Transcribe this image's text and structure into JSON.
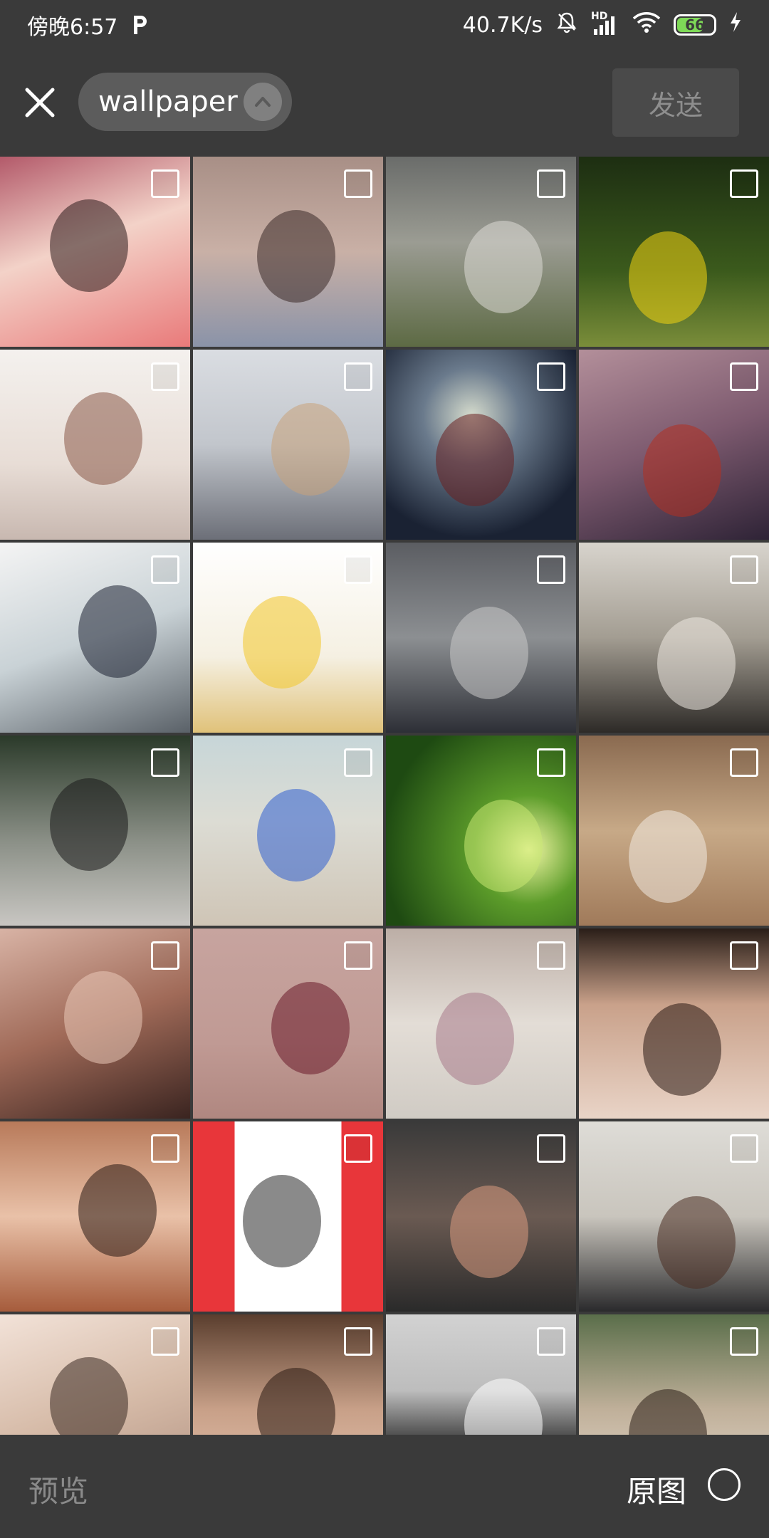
{
  "status_bar": {
    "time": "傍晚6:57",
    "app_icon": "p-icon",
    "network_speed": "40.7K/s",
    "hd_label": "HD",
    "battery_level": "66",
    "icons": [
      "mute-icon",
      "signal-icon",
      "wifi-icon",
      "battery-icon",
      "charging-icon"
    ]
  },
  "header": {
    "close_icon": "close-icon",
    "album_name": "wallpaper",
    "album_toggle_icon": "chevron-up-icon",
    "send_label": "发送"
  },
  "grid": {
    "columns": 4,
    "tiles": [
      {
        "name": "girl-kimono-photo",
        "bg": "linear-gradient(160deg,#b35a6a 0%,#f3d2c8 45%,#e97a7a 100%)",
        "accent": "#2b1b1b"
      },
      {
        "name": "girl-sitting-photo",
        "bg": "linear-gradient(180deg,#a88f86 0%,#c9b0a6 50%,#8a93a8 100%)",
        "accent": "#3a2a28"
      },
      {
        "name": "man-field-photo",
        "bg": "linear-gradient(180deg,#6a6c6a 0%,#9b9c93 45%,#5d6a44 100%)",
        "accent": "#dcdad5"
      },
      {
        "name": "yellow-flowers-photo",
        "bg": "linear-gradient(180deg,#1d2e12 0%,#3b5a1c 60%,#7a8d3a 100%)",
        "accent": "#f2d413"
      },
      {
        "name": "anime-couple-illustration",
        "bg": "linear-gradient(180deg,#f4f1ee 0%,#e8ddd6 60%,#c8b8b0 100%)",
        "accent": "#8a5a48"
      },
      {
        "name": "sleeping-dog-photo",
        "bg": "linear-gradient(180deg,#dadde2 0%,#c2c6cc 50%,#6c6f78 100%)",
        "accent": "#c9a27a"
      },
      {
        "name": "moon-window-illustration",
        "bg": "radial-gradient(circle at 45% 35%,#d6dccd 0%,#6a7a8c 30%,#1a2233 75%)",
        "accent": "#6a2020"
      },
      {
        "name": "figure-on-sofa-illustration",
        "bg": "linear-gradient(160deg,#b38f9a 0%,#7d5a6f 50%,#2e2336 100%)",
        "accent": "#b23020"
      },
      {
        "name": "figure-fishbowl-illustration",
        "bg": "linear-gradient(160deg,#f4f4f4 0%,#c9d2d6 50%,#5a6168 100%)",
        "accent": "#1d2233"
      },
      {
        "name": "minion-agnes-illustration",
        "bg": "linear-gradient(180deg,#ffffff 0%,#f5f0e2 60%,#e0c27a 100%)",
        "accent": "#f3c728"
      },
      {
        "name": "two-cats-photo",
        "bg": "linear-gradient(180deg,#5b5d62 0%,#8c8f92 50%,#2d2f36 100%)",
        "accent": "#c9c9c9"
      },
      {
        "name": "bulldogs-photo",
        "bg": "linear-gradient(180deg,#d8d4cd 0%,#a39d92 50%,#2d2a27 100%)",
        "accent": "#efeae2"
      },
      {
        "name": "girl-under-tree-photo",
        "bg": "linear-gradient(180deg,#2b3a2a 0%,#8a8f86 55%,#c8c6c2 100%)",
        "accent": "#1a1a1a"
      },
      {
        "name": "beach-toy-photo",
        "bg": "linear-gradient(180deg,#c7d6d8 0%,#dcdcd4 45%,#cfc5b6 100%)",
        "accent": "#2f5fcf"
      },
      {
        "name": "bamboo-forest-photo",
        "bg": "radial-gradient(circle at 75% 60%,#f2f7a4 0%,#5c9c2a 30%,#1e4a12 80%)",
        "accent": "#c8e872"
      },
      {
        "name": "girl-legs-photo",
        "bg": "linear-gradient(180deg,#8a6a50 0%,#c7a987 50%,#a07a5a 100%)",
        "accent": "#f1e9e0"
      },
      {
        "name": "girl-face-closeup-photo",
        "bg": "linear-gradient(160deg,#d8b3a5 0%,#a06a58 50%,#3a2420 100%)",
        "accent": "#e9c9b8"
      },
      {
        "name": "braided-hair-illustration",
        "bg": "linear-gradient(180deg,#c7a49f 0%,#c09a94 60%,#b08780 100%)",
        "accent": "#6a1a2a"
      },
      {
        "name": "walking-legs-photo",
        "bg": "linear-gradient(180deg,#bcaea6 0%,#e3ddd6 50%,#d0cbc4 100%)",
        "accent": "#a87a8a"
      },
      {
        "name": "girl-bangs-portrait-photo",
        "bg": "linear-gradient(180deg,#2a1e18 0%,#c9a18a 40%,#e9d4c7 100%)",
        "accent": "#2a1a14"
      },
      {
        "name": "girl-round-glasses-photo",
        "bg": "linear-gradient(180deg,#b87a5a 0%,#e9c1a8 50%,#a65c3c 100%)",
        "accent": "#2a1a14"
      },
      {
        "name": "red-white-illustration",
        "bg": "linear-gradient(90deg,#e8363a 0%,#e8363a 22%,#ffffff 22%,#ffffff 78%,#e8363a 78%)",
        "accent": "#2a2a2a"
      },
      {
        "name": "woman-shopping-cart-photo",
        "bg": "linear-gradient(180deg,#3a3a3a 0%,#6a5a52 50%,#2a2a2a 100%)",
        "accent": "#d89a80"
      },
      {
        "name": "hair-bun-photo",
        "bg": "linear-gradient(180deg,#dedcd7 0%,#c9c5bd 50%,#2a2a2c 100%)",
        "accent": "#4a2e22"
      },
      {
        "name": "girl-profile-photo",
        "bg": "linear-gradient(160deg,#f2e2d8 0%,#d6bba8 50%,#b09080 100%)",
        "accent": "#3a2a22"
      },
      {
        "name": "girl-hand-chin-photo",
        "bg": "linear-gradient(180deg,#5a3e2e 0%,#c8a088 50%,#e9c9b4 100%)",
        "accent": "#2a1a12"
      },
      {
        "name": "black-shirt-photo",
        "bg": "linear-gradient(180deg,#d2d2d2 0%,#bdbdbd 40%,#1a1a1a 75%)",
        "accent": "#ffffff"
      },
      {
        "name": "girl-forest-photo",
        "bg": "linear-gradient(180deg,#5a6e4a 0%,#c0b09a 50%,#e8dcd0 100%)",
        "accent": "#2a1e16"
      }
    ]
  },
  "bottom_bar": {
    "preview_label": "预览",
    "original_label": "原图",
    "original_radio_icon": "radio-unchecked-icon"
  },
  "colors": {
    "background": "#3a3a3a",
    "send_button_bg": "#4a4a4a",
    "disabled_text": "#8a8a8a",
    "pill_bg": "#5c5c5c",
    "battery_fill": "#7ed957"
  }
}
